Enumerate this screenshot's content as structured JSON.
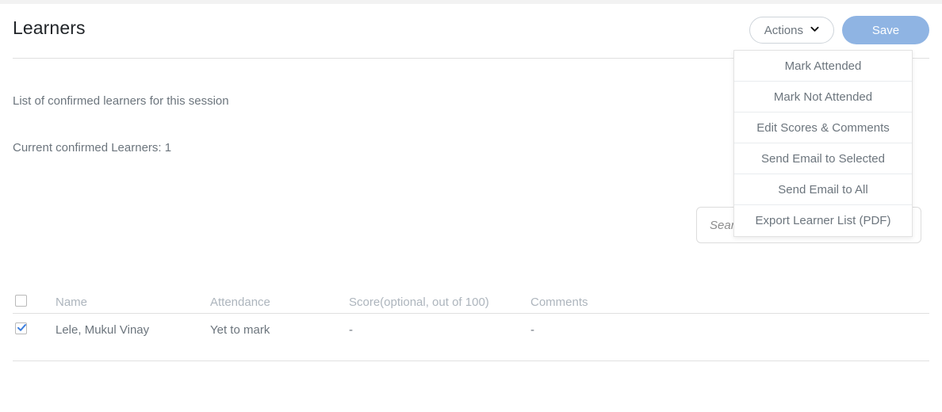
{
  "header": {
    "title": "Learners",
    "actions_button": {
      "label": "Actions",
      "icon": "chevron-down-icon"
    },
    "save_button": {
      "label": "Save",
      "color": "#8fb4e3"
    }
  },
  "dropdown": {
    "open": true,
    "items": [
      {
        "label": "Mark Attended"
      },
      {
        "label": "Mark Not Attended"
      },
      {
        "label": "Edit Scores & Comments"
      },
      {
        "label": "Send Email to Selected"
      },
      {
        "label": "Send Email to All"
      },
      {
        "label": "Export Learner List (PDF)"
      }
    ]
  },
  "body": {
    "description": "List of confirmed learners for this session",
    "count_text": "Current confirmed Learners: 1"
  },
  "search": {
    "value": "",
    "placeholder": "Search..."
  },
  "table": {
    "columns": {
      "name": "Name",
      "attendance": "Attendance",
      "score": "Score(optional, out of 100)",
      "comments": "Comments"
    },
    "select_all_checked": false,
    "rows": [
      {
        "checked": true,
        "name": "Lele, Mukul Vinay",
        "attendance": "Yet to mark",
        "score": "-",
        "comments": "-"
      }
    ]
  }
}
